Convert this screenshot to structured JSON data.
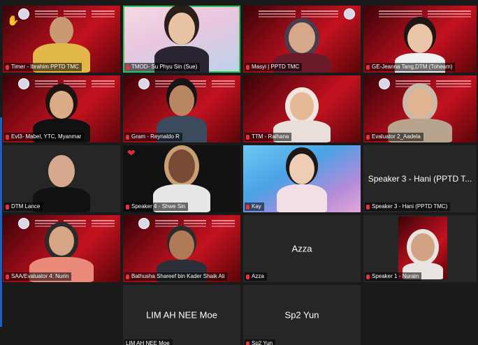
{
  "tiles": [
    {
      "label": "Timer - Ibrahim PPTD TMC",
      "reaction": "✋"
    },
    {
      "label": "TMOD- Su Phyu Sin (Sue)"
    },
    {
      "label": "Masyi | PPTD TMC"
    },
    {
      "label": "GE-Jeanna Tang,DTM (Toheam)"
    },
    {
      "label": "Evl3- Mabel, YTC, Myanmar"
    },
    {
      "label": "Gram - Reynaldo R"
    },
    {
      "label": "TTM - Raihana"
    },
    {
      "label": "Evaluator 2_Aadela"
    },
    {
      "label": "DTM Lance"
    },
    {
      "label": "Speaker 4 - Shwe Sin",
      "reaction": "❤"
    },
    {
      "label": "Kay"
    },
    {
      "label": "Speaker 3 - Hani (PPTD TMC)",
      "display_name": "Speaker 3 - Hani (PPTD T..."
    },
    {
      "label": "SAA/Evaluator 4: Nurin"
    },
    {
      "label": "Bathusha Shareef bin Kader Shaik Ali"
    },
    {
      "label": "Azza",
      "display_name": "Azza"
    },
    {
      "label": "Speaker 1 - Nurain"
    },
    {
      "label": "LIM AH NEE Moe",
      "display_name": "LIM AH NEE Moe"
    },
    {
      "label": "Sp2 Yun",
      "display_name": "Sp2 Yun"
    }
  ],
  "colors": {
    "active_speaker": "#32c25a",
    "mic_muted": "#e8323e",
    "tile_bg": "#262626"
  }
}
